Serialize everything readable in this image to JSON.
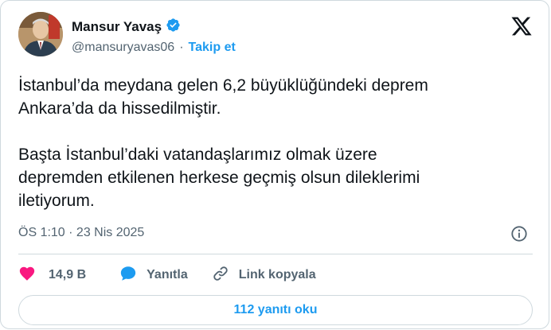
{
  "author": {
    "display_name": "Mansur Yavaş",
    "handle": "@mansuryavas06",
    "separator": "·",
    "follow_label": "Takip et"
  },
  "tweet": {
    "text": "İstanbul’da meydana gelen 6,2 büyüklüğündeki deprem\nAnkara’da da hissedilmiştir.\n\nBaşta İstanbul’daki vatandaşlarımız olmak üzere\ndepremden etkilenen herkese geçmiş olsun dileklerimi\niletiyorum.",
    "timestamp": "ÖS 1:10 · 23 Nis 2025"
  },
  "actions": {
    "like_count": "14,9 B",
    "reply_label": "Yanıtla",
    "copy_link_label": "Link kopyala"
  },
  "read_replies_label": "112 yanıtı oku",
  "colors": {
    "accent": "#1d9bf0",
    "like": "#f91880",
    "text": "#0f1419",
    "muted": "#536471",
    "border": "#cfd9de"
  },
  "icons": {
    "verified": "verified-badge-icon",
    "brand": "x-logo-icon",
    "info": "info-icon",
    "like": "heart-icon",
    "reply": "speech-bubble-icon",
    "copy_link": "link-icon"
  }
}
